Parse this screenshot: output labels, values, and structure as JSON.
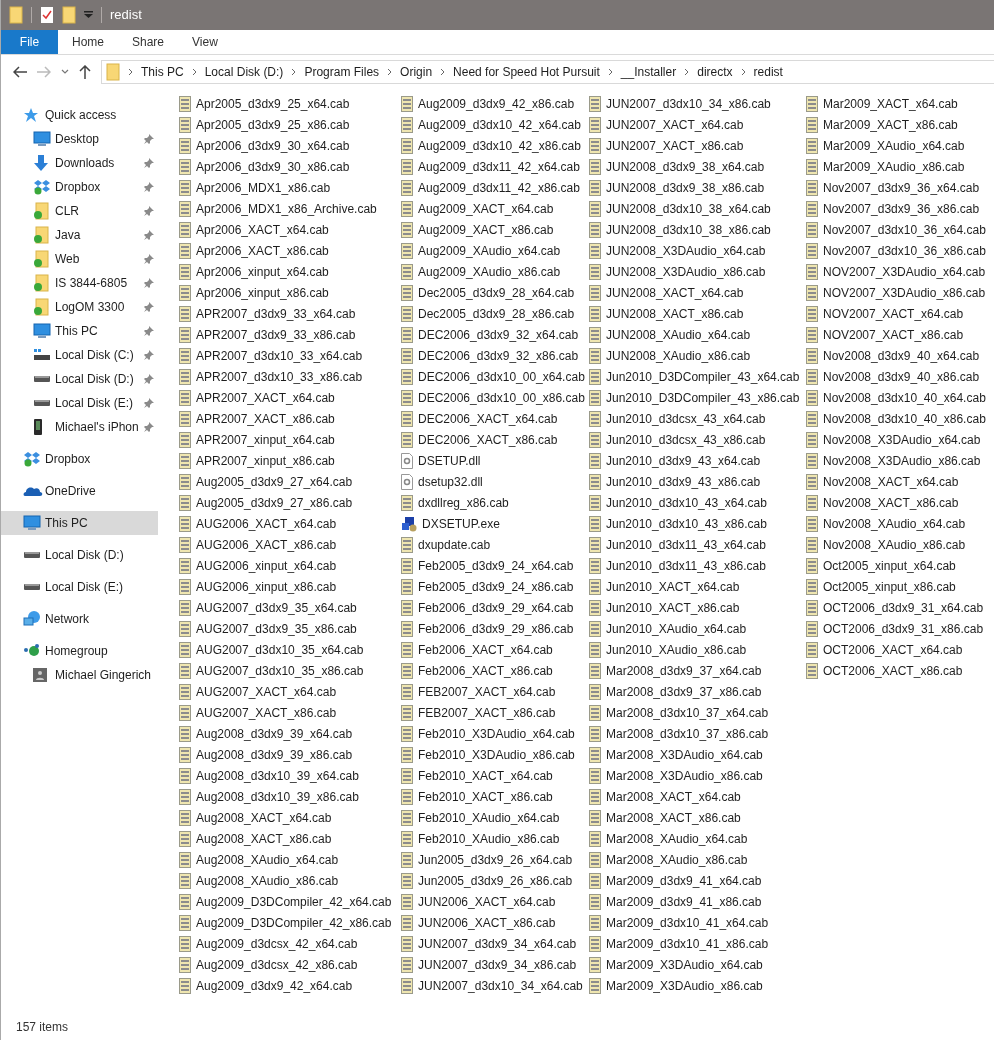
{
  "window": {
    "title": "redist"
  },
  "ribbon_tabs": [
    {
      "label": "File",
      "selected": true
    },
    {
      "label": "Home",
      "selected": false
    },
    {
      "label": "Share",
      "selected": false
    },
    {
      "label": "View",
      "selected": false
    }
  ],
  "address": {
    "crumbs": [
      "This PC",
      "Local Disk (D:)",
      "Program Files",
      "Origin",
      "Need for Speed Hot Pursuit",
      "__Installer",
      "directx",
      "redist"
    ]
  },
  "navigation": [
    {
      "label": "Quick access",
      "kind": "star",
      "selected": false,
      "children": [
        {
          "label": "Desktop",
          "kind": "desktop",
          "pinned": true,
          "selected": false
        },
        {
          "label": "Downloads",
          "kind": "downloads",
          "pinned": true,
          "selected": false
        },
        {
          "label": "Dropbox",
          "kind": "dropbox",
          "pinned": true,
          "selected": false
        },
        {
          "label": "CLR",
          "kind": "synced",
          "pinned": true,
          "selected": false
        },
        {
          "label": "Java",
          "kind": "synced",
          "pinned": true,
          "selected": false
        },
        {
          "label": "Web",
          "kind": "synced",
          "pinned": true,
          "selected": false
        },
        {
          "label": "IS 3844-6805",
          "kind": "synced",
          "pinned": true,
          "selected": false
        },
        {
          "label": "LogOM 3300",
          "kind": "synced",
          "pinned": true,
          "selected": false
        },
        {
          "label": "This PC",
          "kind": "desktop",
          "pinned": true,
          "selected": false
        },
        {
          "label": "Local Disk (C:)",
          "kind": "system",
          "pinned": true,
          "selected": false
        },
        {
          "label": "Local Disk (D:)",
          "kind": "drive",
          "pinned": true,
          "selected": false
        },
        {
          "label": "Local Disk (E:)",
          "kind": "drive",
          "pinned": true,
          "selected": false
        },
        {
          "label": "Michael's iPhon",
          "kind": "phone",
          "pinned": true,
          "selected": false
        }
      ]
    },
    {
      "label": "Dropbox",
      "kind": "dropbox",
      "selected": false
    },
    {
      "label": "OneDrive",
      "kind": "cloud",
      "selected": false
    },
    {
      "label": "This PC",
      "kind": "desktop",
      "selected": true
    },
    {
      "label": "Local Disk (D:)",
      "kind": "drive",
      "selected": false
    },
    {
      "label": "Local Disk (E:)",
      "kind": "drive",
      "selected": false
    },
    {
      "label": "Network",
      "kind": "network",
      "selected": false
    },
    {
      "label": "Homegroup",
      "kind": "homegroup",
      "selected": false,
      "children": [
        {
          "label": "Michael Gingerich",
          "kind": "user",
          "selected": false
        }
      ]
    }
  ],
  "files": [
    {
      "name": "Apr2005_d3dx9_25_x64.cab",
      "kind": "cab"
    },
    {
      "name": "Apr2005_d3dx9_25_x86.cab",
      "kind": "cab"
    },
    {
      "name": "Apr2006_d3dx9_30_x64.cab",
      "kind": "cab"
    },
    {
      "name": "Apr2006_d3dx9_30_x86.cab",
      "kind": "cab"
    },
    {
      "name": "Apr2006_MDX1_x86.cab",
      "kind": "cab"
    },
    {
      "name": "Apr2006_MDX1_x86_Archive.cab",
      "kind": "cab"
    },
    {
      "name": "Apr2006_XACT_x64.cab",
      "kind": "cab"
    },
    {
      "name": "Apr2006_XACT_x86.cab",
      "kind": "cab"
    },
    {
      "name": "Apr2006_xinput_x64.cab",
      "kind": "cab"
    },
    {
      "name": "Apr2006_xinput_x86.cab",
      "kind": "cab"
    },
    {
      "name": "APR2007_d3dx9_33_x64.cab",
      "kind": "cab"
    },
    {
      "name": "APR2007_d3dx9_33_x86.cab",
      "kind": "cab"
    },
    {
      "name": "APR2007_d3dx10_33_x64.cab",
      "kind": "cab"
    },
    {
      "name": "APR2007_d3dx10_33_x86.cab",
      "kind": "cab"
    },
    {
      "name": "APR2007_XACT_x64.cab",
      "kind": "cab"
    },
    {
      "name": "APR2007_XACT_x86.cab",
      "kind": "cab"
    },
    {
      "name": "APR2007_xinput_x64.cab",
      "kind": "cab"
    },
    {
      "name": "APR2007_xinput_x86.cab",
      "kind": "cab"
    },
    {
      "name": "Aug2005_d3dx9_27_x64.cab",
      "kind": "cab"
    },
    {
      "name": "Aug2005_d3dx9_27_x86.cab",
      "kind": "cab"
    },
    {
      "name": "AUG2006_XACT_x64.cab",
      "kind": "cab"
    },
    {
      "name": "AUG2006_XACT_x86.cab",
      "kind": "cab"
    },
    {
      "name": "AUG2006_xinput_x64.cab",
      "kind": "cab"
    },
    {
      "name": "AUG2006_xinput_x86.cab",
      "kind": "cab"
    },
    {
      "name": "AUG2007_d3dx9_35_x64.cab",
      "kind": "cab"
    },
    {
      "name": "AUG2007_d3dx9_35_x86.cab",
      "kind": "cab"
    },
    {
      "name": "AUG2007_d3dx10_35_x64.cab",
      "kind": "cab"
    },
    {
      "name": "AUG2007_d3dx10_35_x86.cab",
      "kind": "cab"
    },
    {
      "name": "AUG2007_XACT_x64.cab",
      "kind": "cab"
    },
    {
      "name": "AUG2007_XACT_x86.cab",
      "kind": "cab"
    },
    {
      "name": "Aug2008_d3dx9_39_x64.cab",
      "kind": "cab"
    },
    {
      "name": "Aug2008_d3dx9_39_x86.cab",
      "kind": "cab"
    },
    {
      "name": "Aug2008_d3dx10_39_x64.cab",
      "kind": "cab"
    },
    {
      "name": "Aug2008_d3dx10_39_x86.cab",
      "kind": "cab"
    },
    {
      "name": "Aug2008_XACT_x64.cab",
      "kind": "cab"
    },
    {
      "name": "Aug2008_XACT_x86.cab",
      "kind": "cab"
    },
    {
      "name": "Aug2008_XAudio_x64.cab",
      "kind": "cab"
    },
    {
      "name": "Aug2008_XAudio_x86.cab",
      "kind": "cab"
    },
    {
      "name": "Aug2009_D3DCompiler_42_x64.cab",
      "kind": "cab"
    },
    {
      "name": "Aug2009_D3DCompiler_42_x86.cab",
      "kind": "cab"
    },
    {
      "name": "Aug2009_d3dcsx_42_x64.cab",
      "kind": "cab"
    },
    {
      "name": "Aug2009_d3dcsx_42_x86.cab",
      "kind": "cab"
    },
    {
      "name": "Aug2009_d3dx9_42_x64.cab",
      "kind": "cab"
    },
    {
      "name": "Aug2009_d3dx9_42_x86.cab",
      "kind": "cab"
    },
    {
      "name": "Aug2009_d3dx10_42_x64.cab",
      "kind": "cab"
    },
    {
      "name": "Aug2009_d3dx10_42_x86.cab",
      "kind": "cab"
    },
    {
      "name": "Aug2009_d3dx11_42_x64.cab",
      "kind": "cab"
    },
    {
      "name": "Aug2009_d3dx11_42_x86.cab",
      "kind": "cab"
    },
    {
      "name": "Aug2009_XACT_x64.cab",
      "kind": "cab"
    },
    {
      "name": "Aug2009_XACT_x86.cab",
      "kind": "cab"
    },
    {
      "name": "Aug2009_XAudio_x64.cab",
      "kind": "cab"
    },
    {
      "name": "Aug2009_XAudio_x86.cab",
      "kind": "cab"
    },
    {
      "name": "Dec2005_d3dx9_28_x64.cab",
      "kind": "cab"
    },
    {
      "name": "Dec2005_d3dx9_28_x86.cab",
      "kind": "cab"
    },
    {
      "name": "DEC2006_d3dx9_32_x64.cab",
      "kind": "cab"
    },
    {
      "name": "DEC2006_d3dx9_32_x86.cab",
      "kind": "cab"
    },
    {
      "name": "DEC2006_d3dx10_00_x64.cab",
      "kind": "cab"
    },
    {
      "name": "DEC2006_d3dx10_00_x86.cab",
      "kind": "cab"
    },
    {
      "name": "DEC2006_XACT_x64.cab",
      "kind": "cab"
    },
    {
      "name": "DEC2006_XACT_x86.cab",
      "kind": "cab"
    },
    {
      "name": "DSETUP.dll",
      "kind": "dll"
    },
    {
      "name": "dsetup32.dll",
      "kind": "dll"
    },
    {
      "name": "dxdllreg_x86.cab",
      "kind": "cab"
    },
    {
      "name": "DXSETUP.exe",
      "kind": "exe"
    },
    {
      "name": "dxupdate.cab",
      "kind": "cab"
    },
    {
      "name": "Feb2005_d3dx9_24_x64.cab",
      "kind": "cab"
    },
    {
      "name": "Feb2005_d3dx9_24_x86.cab",
      "kind": "cab"
    },
    {
      "name": "Feb2006_d3dx9_29_x64.cab",
      "kind": "cab"
    },
    {
      "name": "Feb2006_d3dx9_29_x86.cab",
      "kind": "cab"
    },
    {
      "name": "Feb2006_XACT_x64.cab",
      "kind": "cab"
    },
    {
      "name": "Feb2006_XACT_x86.cab",
      "kind": "cab"
    },
    {
      "name": "FEB2007_XACT_x64.cab",
      "kind": "cab"
    },
    {
      "name": "FEB2007_XACT_x86.cab",
      "kind": "cab"
    },
    {
      "name": "Feb2010_X3DAudio_x64.cab",
      "kind": "cab"
    },
    {
      "name": "Feb2010_X3DAudio_x86.cab",
      "kind": "cab"
    },
    {
      "name": "Feb2010_XACT_x64.cab",
      "kind": "cab"
    },
    {
      "name": "Feb2010_XACT_x86.cab",
      "kind": "cab"
    },
    {
      "name": "Feb2010_XAudio_x64.cab",
      "kind": "cab"
    },
    {
      "name": "Feb2010_XAudio_x86.cab",
      "kind": "cab"
    },
    {
      "name": "Jun2005_d3dx9_26_x64.cab",
      "kind": "cab"
    },
    {
      "name": "Jun2005_d3dx9_26_x86.cab",
      "kind": "cab"
    },
    {
      "name": "JUN2006_XACT_x64.cab",
      "kind": "cab"
    },
    {
      "name": "JUN2006_XACT_x86.cab",
      "kind": "cab"
    },
    {
      "name": "JUN2007_d3dx9_34_x64.cab",
      "kind": "cab"
    },
    {
      "name": "JUN2007_d3dx9_34_x86.cab",
      "kind": "cab"
    },
    {
      "name": "JUN2007_d3dx10_34_x64.cab",
      "kind": "cab"
    },
    {
      "name": "JUN2007_d3dx10_34_x86.cab",
      "kind": "cab"
    },
    {
      "name": "JUN2007_XACT_x64.cab",
      "kind": "cab"
    },
    {
      "name": "JUN2007_XACT_x86.cab",
      "kind": "cab"
    },
    {
      "name": "JUN2008_d3dx9_38_x64.cab",
      "kind": "cab"
    },
    {
      "name": "JUN2008_d3dx9_38_x86.cab",
      "kind": "cab"
    },
    {
      "name": "JUN2008_d3dx10_38_x64.cab",
      "kind": "cab"
    },
    {
      "name": "JUN2008_d3dx10_38_x86.cab",
      "kind": "cab"
    },
    {
      "name": "JUN2008_X3DAudio_x64.cab",
      "kind": "cab"
    },
    {
      "name": "JUN2008_X3DAudio_x86.cab",
      "kind": "cab"
    },
    {
      "name": "JUN2008_XACT_x64.cab",
      "kind": "cab"
    },
    {
      "name": "JUN2008_XACT_x86.cab",
      "kind": "cab"
    },
    {
      "name": "JUN2008_XAudio_x64.cab",
      "kind": "cab"
    },
    {
      "name": "JUN2008_XAudio_x86.cab",
      "kind": "cab"
    },
    {
      "name": "Jun2010_D3DCompiler_43_x64.cab",
      "kind": "cab"
    },
    {
      "name": "Jun2010_D3DCompiler_43_x86.cab",
      "kind": "cab"
    },
    {
      "name": "Jun2010_d3dcsx_43_x64.cab",
      "kind": "cab"
    },
    {
      "name": "Jun2010_d3dcsx_43_x86.cab",
      "kind": "cab"
    },
    {
      "name": "Jun2010_d3dx9_43_x64.cab",
      "kind": "cab"
    },
    {
      "name": "Jun2010_d3dx9_43_x86.cab",
      "kind": "cab"
    },
    {
      "name": "Jun2010_d3dx10_43_x64.cab",
      "kind": "cab"
    },
    {
      "name": "Jun2010_d3dx10_43_x86.cab",
      "kind": "cab"
    },
    {
      "name": "Jun2010_d3dx11_43_x64.cab",
      "kind": "cab"
    },
    {
      "name": "Jun2010_d3dx11_43_x86.cab",
      "kind": "cab"
    },
    {
      "name": "Jun2010_XACT_x64.cab",
      "kind": "cab"
    },
    {
      "name": "Jun2010_XACT_x86.cab",
      "kind": "cab"
    },
    {
      "name": "Jun2010_XAudio_x64.cab",
      "kind": "cab"
    },
    {
      "name": "Jun2010_XAudio_x86.cab",
      "kind": "cab"
    },
    {
      "name": "Mar2008_d3dx9_37_x64.cab",
      "kind": "cab"
    },
    {
      "name": "Mar2008_d3dx9_37_x86.cab",
      "kind": "cab"
    },
    {
      "name": "Mar2008_d3dx10_37_x64.cab",
      "kind": "cab"
    },
    {
      "name": "Mar2008_d3dx10_37_x86.cab",
      "kind": "cab"
    },
    {
      "name": "Mar2008_X3DAudio_x64.cab",
      "kind": "cab"
    },
    {
      "name": "Mar2008_X3DAudio_x86.cab",
      "kind": "cab"
    },
    {
      "name": "Mar2008_XACT_x64.cab",
      "kind": "cab"
    },
    {
      "name": "Mar2008_XACT_x86.cab",
      "kind": "cab"
    },
    {
      "name": "Mar2008_XAudio_x64.cab",
      "kind": "cab"
    },
    {
      "name": "Mar2008_XAudio_x86.cab",
      "kind": "cab"
    },
    {
      "name": "Mar2009_d3dx9_41_x64.cab",
      "kind": "cab"
    },
    {
      "name": "Mar2009_d3dx9_41_x86.cab",
      "kind": "cab"
    },
    {
      "name": "Mar2009_d3dx10_41_x64.cab",
      "kind": "cab"
    },
    {
      "name": "Mar2009_d3dx10_41_x86.cab",
      "kind": "cab"
    },
    {
      "name": "Mar2009_X3DAudio_x64.cab",
      "kind": "cab"
    },
    {
      "name": "Mar2009_X3DAudio_x86.cab",
      "kind": "cab"
    },
    {
      "name": "Mar2009_XACT_x64.cab",
      "kind": "cab"
    },
    {
      "name": "Mar2009_XACT_x86.cab",
      "kind": "cab"
    },
    {
      "name": "Mar2009_XAudio_x64.cab",
      "kind": "cab"
    },
    {
      "name": "Mar2009_XAudio_x86.cab",
      "kind": "cab"
    },
    {
      "name": "Nov2007_d3dx9_36_x64.cab",
      "kind": "cab"
    },
    {
      "name": "Nov2007_d3dx9_36_x86.cab",
      "kind": "cab"
    },
    {
      "name": "Nov2007_d3dx10_36_x64.cab",
      "kind": "cab"
    },
    {
      "name": "Nov2007_d3dx10_36_x86.cab",
      "kind": "cab"
    },
    {
      "name": "NOV2007_X3DAudio_x64.cab",
      "kind": "cab"
    },
    {
      "name": "NOV2007_X3DAudio_x86.cab",
      "kind": "cab"
    },
    {
      "name": "NOV2007_XACT_x64.cab",
      "kind": "cab"
    },
    {
      "name": "NOV2007_XACT_x86.cab",
      "kind": "cab"
    },
    {
      "name": "Nov2008_d3dx9_40_x64.cab",
      "kind": "cab"
    },
    {
      "name": "Nov2008_d3dx9_40_x86.cab",
      "kind": "cab"
    },
    {
      "name": "Nov2008_d3dx10_40_x64.cab",
      "kind": "cab"
    },
    {
      "name": "Nov2008_d3dx10_40_x86.cab",
      "kind": "cab"
    },
    {
      "name": "Nov2008_X3DAudio_x64.cab",
      "kind": "cab"
    },
    {
      "name": "Nov2008_X3DAudio_x86.cab",
      "kind": "cab"
    },
    {
      "name": "Nov2008_XACT_x64.cab",
      "kind": "cab"
    },
    {
      "name": "Nov2008_XACT_x86.cab",
      "kind": "cab"
    },
    {
      "name": "Nov2008_XAudio_x64.cab",
      "kind": "cab"
    },
    {
      "name": "Nov2008_XAudio_x86.cab",
      "kind": "cab"
    },
    {
      "name": "Oct2005_xinput_x64.cab",
      "kind": "cab"
    },
    {
      "name": "Oct2005_xinput_x86.cab",
      "kind": "cab"
    },
    {
      "name": "OCT2006_d3dx9_31_x64.cab",
      "kind": "cab"
    },
    {
      "name": "OCT2006_d3dx9_31_x86.cab",
      "kind": "cab"
    },
    {
      "name": "OCT2006_XACT_x64.cab",
      "kind": "cab"
    },
    {
      "name": "OCT2006_XACT_x86.cab",
      "kind": "cab"
    }
  ],
  "status_bar": {
    "item_count": "157 items"
  }
}
